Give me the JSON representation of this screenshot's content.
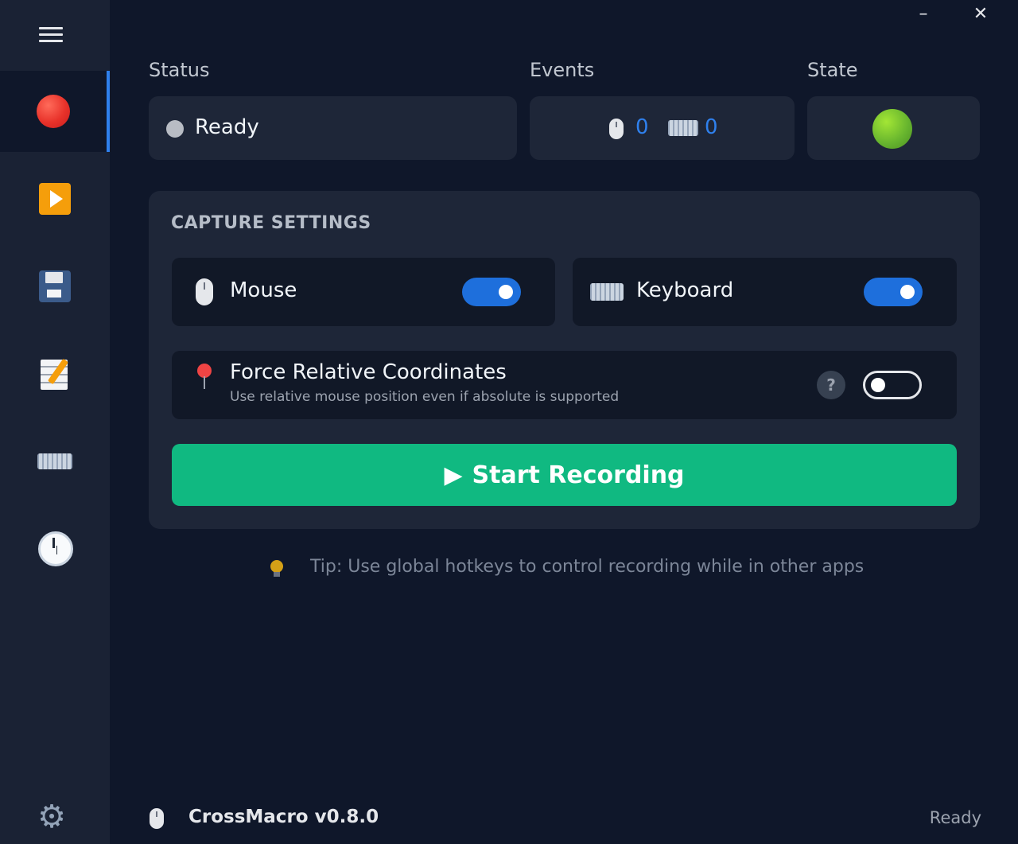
{
  "window": {
    "minimize_symbol": "–",
    "close_symbol": "✕"
  },
  "sidebar": {
    "items": [
      {
        "id": "record",
        "icon": "record-icon",
        "active": true
      },
      {
        "id": "playback",
        "icon": "play-icon",
        "active": false
      },
      {
        "id": "files",
        "icon": "floppy-disk-icon",
        "active": false
      },
      {
        "id": "editor",
        "icon": "memo-icon",
        "active": false
      },
      {
        "id": "text-expansion",
        "icon": "keyboard-icon",
        "active": false
      },
      {
        "id": "schedule",
        "icon": "clock-icon",
        "active": false
      }
    ],
    "settings_icon": "gear-icon"
  },
  "header": {
    "status_label": "Status",
    "events_label": "Events",
    "state_label": "State"
  },
  "status": {
    "text": "Ready"
  },
  "events": {
    "mouse_count": "0",
    "keyboard_count": "0"
  },
  "state": {
    "color": "#65b32e"
  },
  "capture_settings": {
    "title": "CAPTURE SETTINGS",
    "mouse_label": "Mouse",
    "mouse_enabled": true,
    "keyboard_label": "Keyboard",
    "keyboard_enabled": true,
    "force_relative": {
      "title": "Force Relative Coordinates",
      "description": "Use relative mouse position even if absolute is supported",
      "help": "?",
      "enabled": false
    },
    "start_button": "Start Recording",
    "start_symbol": "▶"
  },
  "tip": {
    "text": "Tip: Use global hotkeys to control recording while in other apps"
  },
  "footer": {
    "app_name": "CrossMacro v0.8.0",
    "status": "Ready"
  },
  "colors": {
    "accent": "#2f80ed",
    "primary_button": "#10b981",
    "background": "#0f172a",
    "sidebar": "#1a2234"
  }
}
